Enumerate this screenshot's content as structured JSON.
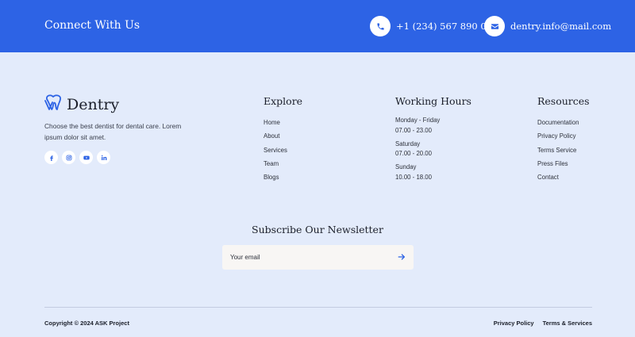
{
  "topbar": {
    "title": "Connect With Us",
    "phone": {
      "text": "+1 (234) 567 890 00",
      "icon": "phone-icon"
    },
    "email": {
      "text": "dentry.info@mail.com",
      "icon": "envelope-icon"
    }
  },
  "brand": {
    "name": "Dentry",
    "logo_icon": "tooth-logo-icon",
    "description": "Choose the best dentist for dental care. Lorem ipsum dolor sit amet."
  },
  "social": [
    "facebook-icon",
    "instagram-icon",
    "youtube-icon",
    "linkedin-icon"
  ],
  "explore": {
    "title": "Explore",
    "items": [
      "Home",
      "About",
      "Services",
      "Team",
      "Blogs"
    ]
  },
  "hours": {
    "title": "Working Hours",
    "blocks": [
      {
        "day": "Monday - Friday",
        "time": "07.00 - 23.00"
      },
      {
        "day": "Saturday",
        "time": "07.00 - 20.00"
      },
      {
        "day": "Sunday",
        "time": "10.00 - 18.00"
      }
    ]
  },
  "resources": {
    "title": "Resources",
    "items": [
      "Documentation",
      "Privacy Policy",
      "Terms Service",
      "Press Files",
      "Contact"
    ]
  },
  "newsletter": {
    "title": "Subscribe Our Newsletter",
    "placeholder": "Your email",
    "submit_icon": "arrow-right-icon"
  },
  "footer": {
    "copyright": "Copyright © 2024 ASK Project",
    "links": [
      "Privacy Policy",
      "Terms & Services"
    ]
  },
  "colors": {
    "primary": "#2d63e5",
    "background": "#e3ebfb",
    "text": "#1b1f2a"
  }
}
